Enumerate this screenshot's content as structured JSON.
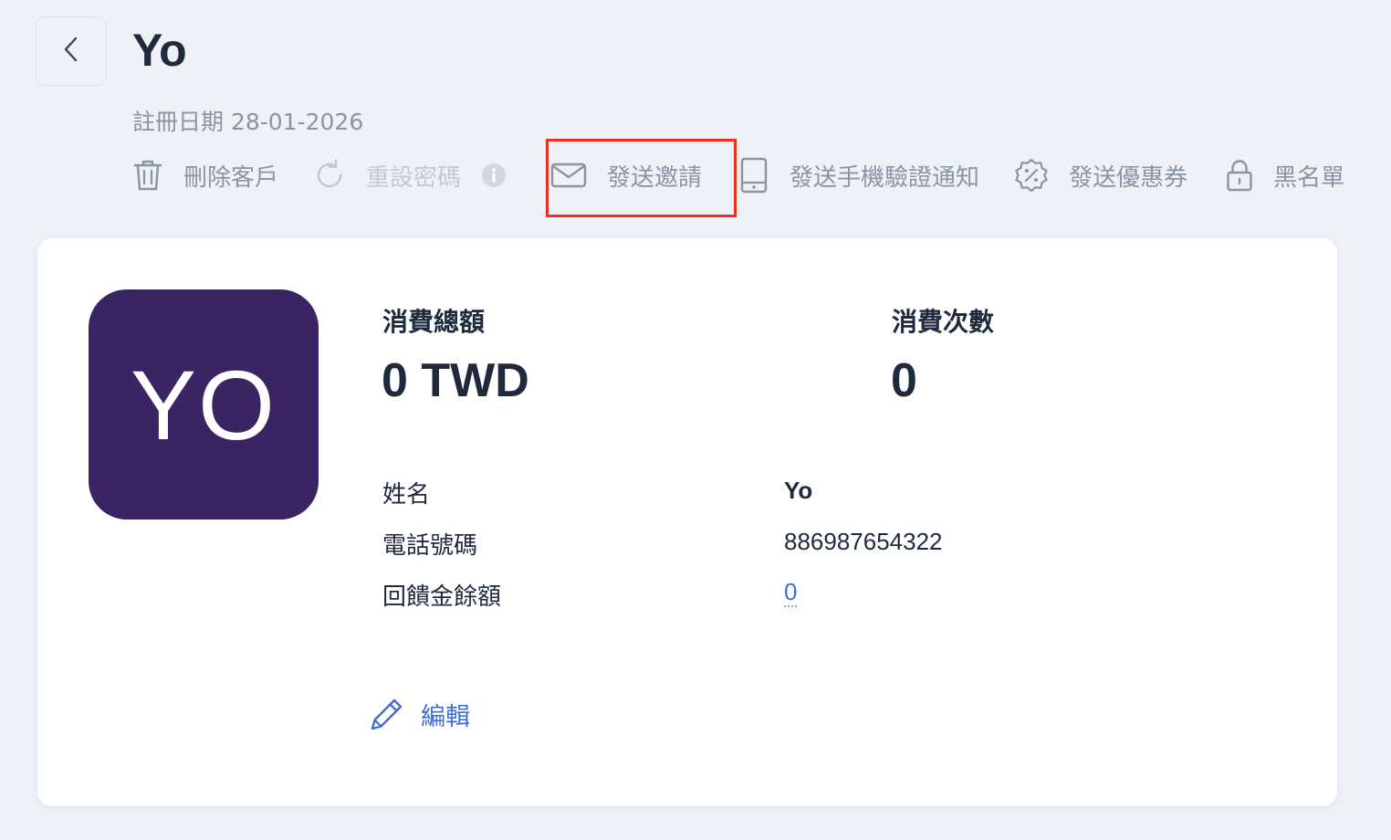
{
  "header": {
    "title": "Yo",
    "registration": "註冊日期 28-01-2026"
  },
  "actions": [
    {
      "label": "刪除客戶",
      "icon": "trash-icon",
      "enabled": true
    },
    {
      "label": "重設密碼",
      "icon": "refresh-icon",
      "enabled": false,
      "info_icon": "info-icon"
    },
    {
      "label": "發送邀請",
      "icon": "mail-icon",
      "enabled": true,
      "highlighted": true
    },
    {
      "label": "發送手機驗證通知",
      "icon": "phone-icon",
      "enabled": true
    },
    {
      "label": "發送優惠券",
      "icon": "coupon-icon",
      "enabled": true
    },
    {
      "label": "黑名單",
      "icon": "lock-icon",
      "enabled": true
    }
  ],
  "customer": {
    "avatar_initials": "YO",
    "stats": {
      "total_spend_label": "消費總額",
      "total_spend_value": "0 TWD",
      "visits_label": "消費次數",
      "visits_value": "0"
    },
    "info": [
      {
        "label": "姓名",
        "value": "Yo"
      },
      {
        "label": "電話號碼",
        "value": "886987654322"
      },
      {
        "label": "回饋金餘額",
        "value": "0"
      }
    ],
    "edit_label": "編輯"
  },
  "colors": {
    "background": "#eef1f5",
    "card": "#ffffff",
    "avatar": "#3b2462",
    "link": "#3d6fd1",
    "muted": "#8a94a3",
    "highlight_border": "#e8321e",
    "text": "#1f2a3d"
  }
}
